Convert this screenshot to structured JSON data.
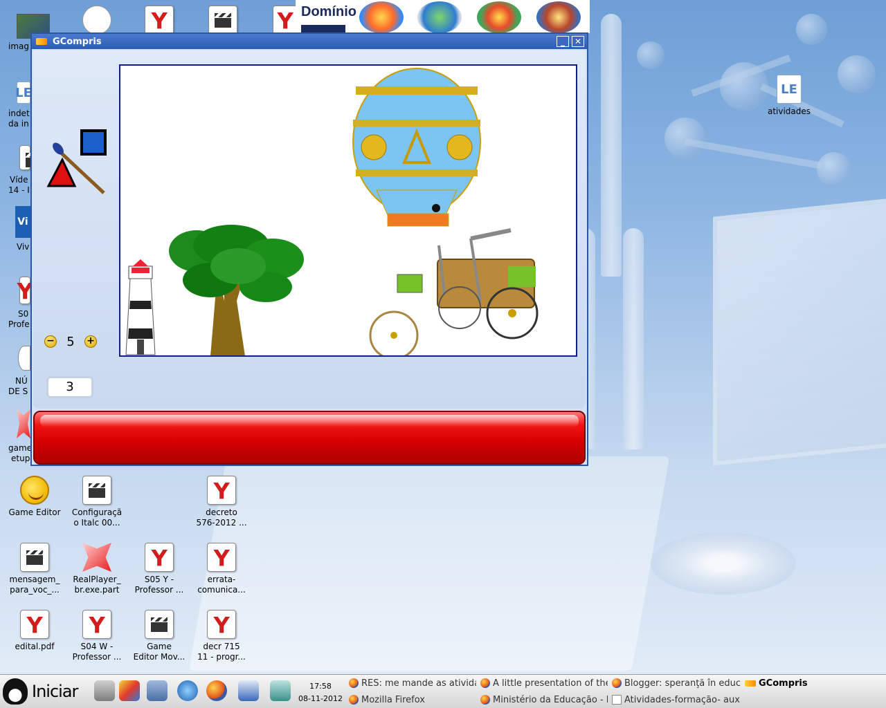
{
  "desktop": {
    "left_icons": [
      {
        "label": "imag"
      },
      {
        "label": "indet"
      },
      {
        "label": "da in"
      },
      {
        "label": "Víde"
      },
      {
        "label": "14 - I"
      },
      {
        "label": "Vi"
      },
      {
        "label": "Viv"
      },
      {
        "label": "S0"
      },
      {
        "label": "Profe"
      },
      {
        "label": "NÚ"
      },
      {
        "label": "DE S"
      },
      {
        "label": "game"
      },
      {
        "label": "etup"
      }
    ],
    "atividades": "atividades",
    "dominio_label": "Domínio",
    "icons": [
      {
        "line1": "Game Editor",
        "line2": ""
      },
      {
        "line1": "Configuraçã",
        "line2": "o Italc 00..."
      },
      {
        "line1": "decreto",
        "line2": "576-2012 ..."
      },
      {
        "line1": "mensagem_",
        "line2": "para_voc_..."
      },
      {
        "line1": "RealPlayer_",
        "line2": "br.exe.part"
      },
      {
        "line1": "S05 Y -",
        "line2": "Professor ..."
      },
      {
        "line1": "errata-",
        "line2": "comunica..."
      },
      {
        "line1": "edital.pdf",
        "line2": ""
      },
      {
        "line1": "S04 W -",
        "line2": "Professor ..."
      },
      {
        "line1": "Game",
        "line2": "Editor Mov..."
      },
      {
        "line1": "decr 715",
        "line2": "11 - progr..."
      }
    ]
  },
  "window": {
    "title": "GCompris",
    "minimize": "_",
    "close": "✕",
    "level": "5",
    "level_minus": "−",
    "level_plus": "+",
    "score": "3"
  },
  "taskbar": {
    "start_label": "Iniciar",
    "time": "17:58",
    "date": "08-11-2012",
    "tasks": [
      {
        "label": "RES: me mande as atividad"
      },
      {
        "label": "A little presentation of the"
      },
      {
        "label": "Blogger: speranţă în educ"
      },
      {
        "label": "GCompris"
      },
      {
        "label": "Mozilla Firefox"
      },
      {
        "label": "Ministério da Educação - M"
      },
      {
        "label": "Atividades-formação- auxil"
      }
    ]
  },
  "colors": {
    "titlebar": "#2c5bb3",
    "canvas_border": "#10208a",
    "red_bar": "#d30000"
  }
}
